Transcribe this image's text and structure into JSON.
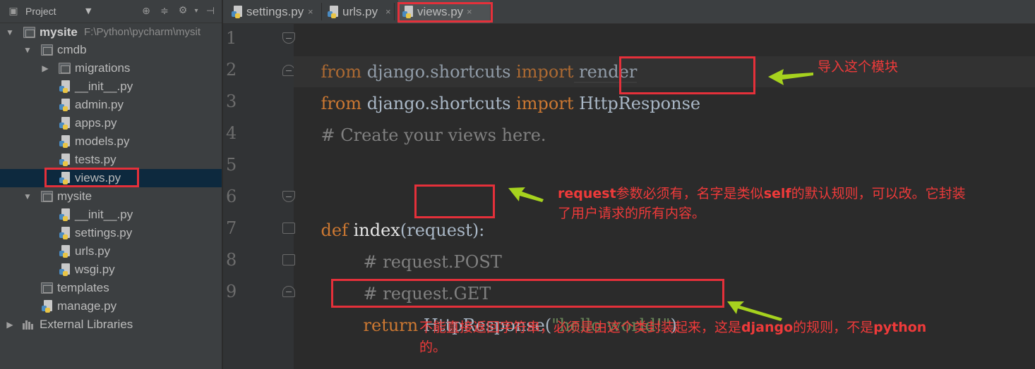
{
  "project_panel": {
    "title": "Project",
    "dropdown": "▼",
    "tree": [
      {
        "label": "mysite",
        "path": "F:\\Python\\pycharm\\mysit"
      },
      {
        "label": "cmdb"
      },
      {
        "label": "migrations"
      },
      {
        "label": "__init__.py"
      },
      {
        "label": "admin.py"
      },
      {
        "label": "apps.py"
      },
      {
        "label": "models.py"
      },
      {
        "label": "tests.py"
      },
      {
        "label": "views.py"
      },
      {
        "label": "mysite"
      },
      {
        "label": "__init__.py"
      },
      {
        "label": "settings.py"
      },
      {
        "label": "urls.py"
      },
      {
        "label": "wsgi.py"
      },
      {
        "label": "templates"
      },
      {
        "label": "manage.py"
      },
      {
        "label": "External Libraries"
      }
    ]
  },
  "tabs": [
    {
      "label": "settings.py",
      "close": "×"
    },
    {
      "label": "urls.py",
      "close": "×"
    },
    {
      "label": "views.py",
      "close": "×"
    }
  ],
  "editor": {
    "line_numbers": [
      "1",
      "2",
      "3",
      "4",
      "5",
      "6",
      "7",
      "8",
      "9"
    ],
    "lines": {
      "l1": {
        "kw1": "from",
        "mid": " django.shortcuts ",
        "kw2": "import",
        "rest": " render"
      },
      "l2": {
        "kw1": "from",
        "mid": " django.shortcuts ",
        "kw2": "import",
        "rest": " HttpResponse"
      },
      "l3": {
        "comment": "# Create your views here."
      },
      "l6": {
        "kw": "def",
        "name": " index",
        "open": "(",
        "param": "request",
        "close": "):"
      },
      "l7": {
        "comment": "# request.POST"
      },
      "l8": {
        "comment": "# request.GET"
      },
      "l9": {
        "kw": "return",
        "call": " HttpResponse(",
        "str": "\"hello world!\"",
        "close": ")"
      }
    }
  },
  "annotations": {
    "import_note": "导入这个模块",
    "request_note_line1_a": "request",
    "request_note_line1_b": "参数必须有，名字是类似",
    "request_note_line1_c": "self",
    "request_note_line1_d": "的默认规则，可以改。它封装",
    "request_note_line2": "了用户请求的所有内容。",
    "return_note_line1_a": "不能直接返回字符串，必须是由这个类封装起来，这是",
    "return_note_line1_b": "django",
    "return_note_line1_c": "的规则，不是",
    "return_note_line1_d": "python",
    "return_note_line2": "的。"
  },
  "colors": {
    "annotation_red": "#e5303a",
    "arrow_green": "#a6d21e",
    "keyword": "#cc7832",
    "string": "#6a8759",
    "comment": "#808080"
  }
}
